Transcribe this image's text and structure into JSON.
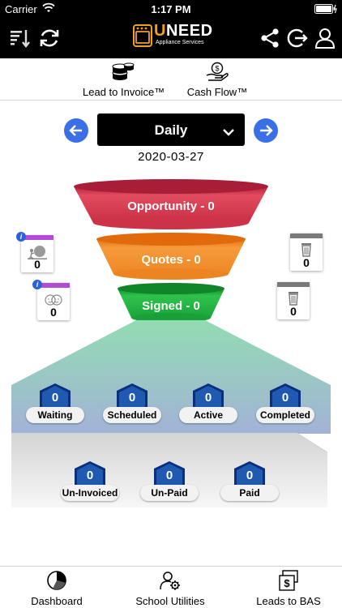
{
  "status_bar": {
    "carrier": "Carrier",
    "time": "1:17 PM"
  },
  "header": {
    "brand_first": "U",
    "brand_rest": "NEED",
    "tagline": "Appliance Services"
  },
  "top_nav": [
    {
      "label": "Lead to Invoice™",
      "icon": "coins-stack-icon"
    },
    {
      "label": "Cash Flow™",
      "icon": "hand-dollar-icon"
    }
  ],
  "period": {
    "selected": "Daily",
    "date": "2020-03-27"
  },
  "funnel": {
    "opportunity": "Opportunity - 0",
    "quotes": "Quotes - 0",
    "signed": "Signed - 0"
  },
  "side_cards": {
    "quotes_left": {
      "value": "0",
      "color": "#b24bd6"
    },
    "quotes_right": {
      "value": "0",
      "color": "#7a7a7a"
    },
    "signed_left": {
      "value": "0",
      "color": "#b24bd6"
    },
    "signed_right": {
      "value": "0",
      "color": "#7a7a7a"
    },
    "info_glyph": "i"
  },
  "jobs": [
    {
      "label": "Waiting",
      "count": "0"
    },
    {
      "label": "Scheduled",
      "count": "0"
    },
    {
      "label": "Active",
      "count": "0"
    },
    {
      "label": "Completed",
      "count": "0"
    }
  ],
  "invoices": [
    {
      "label": "Un-Invoiced",
      "count": "0"
    },
    {
      "label": "Un-Paid",
      "count": "0"
    },
    {
      "label": "Paid",
      "count": "0"
    }
  ],
  "bottom_tabs": [
    {
      "label": "Dashboard",
      "icon": "pie-chart-icon"
    },
    {
      "label": "School Utilities",
      "icon": "user-gear-icon"
    },
    {
      "label": "Leads to BAS",
      "icon": "dollar-document-icon"
    }
  ],
  "colors": {
    "accent_blue": "#3b6fe6",
    "opportunity": "#d23a50",
    "quotes": "#f08a24",
    "signed": "#1eaa3c",
    "brand_orange": "#f2a020"
  }
}
